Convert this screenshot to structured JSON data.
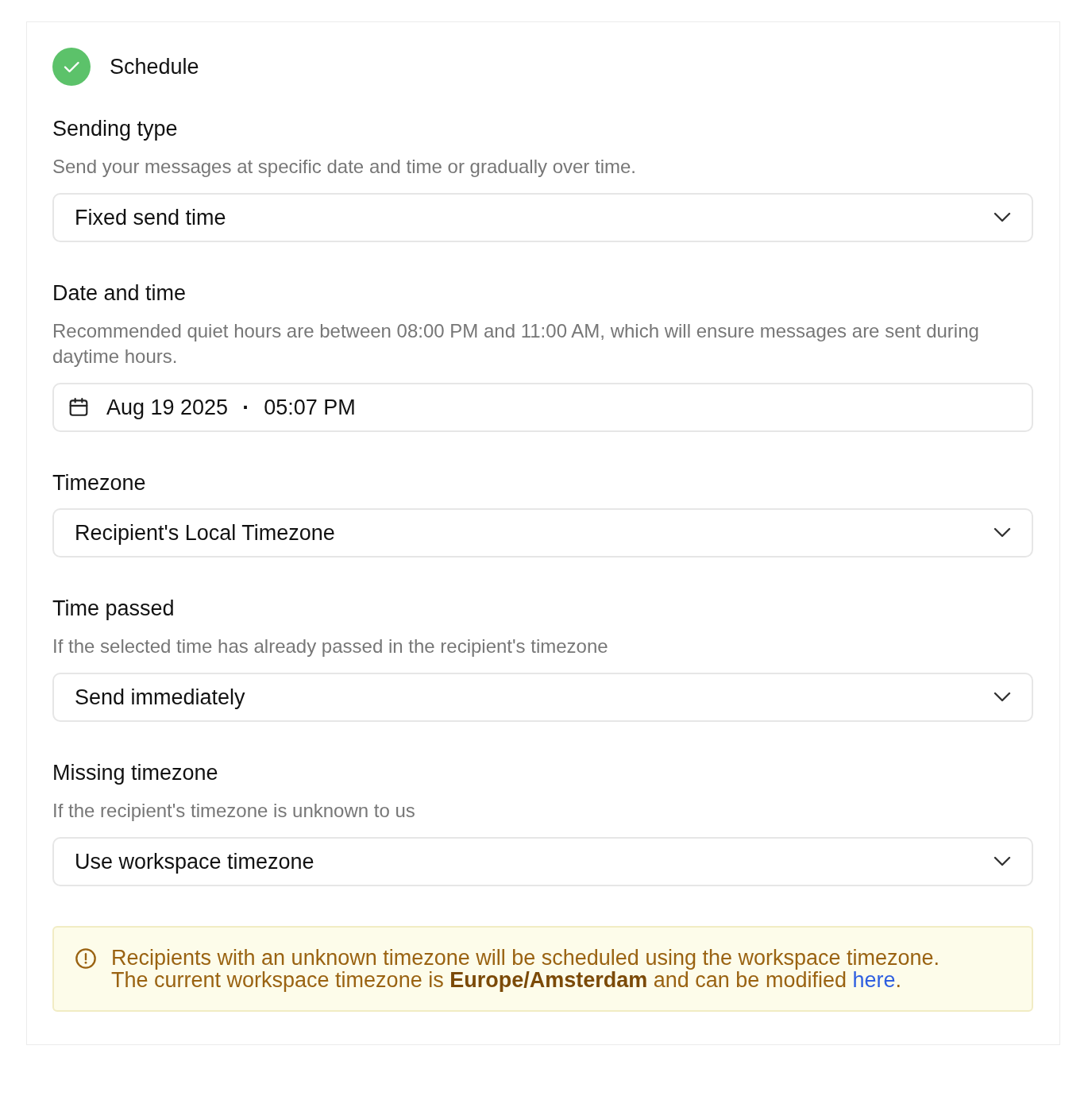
{
  "header": {
    "title": "Schedule",
    "completed": true
  },
  "sections": [
    {
      "kind": "select",
      "title": "Sending type",
      "description": "Send your messages at specific date and time or gradually over time.",
      "value": "Fixed send time"
    },
    {
      "kind": "datetime",
      "title": "Date and time",
      "description": "Recommended quiet hours are between 08:00 PM and 11:00 AM, which will ensure messages are sent during daytime hours.",
      "date": "Aug 19 2025",
      "separator": "·",
      "time": "05:07 PM"
    },
    {
      "kind": "select",
      "title": "Timezone",
      "value": "Recipient's Local Timezone"
    },
    {
      "kind": "select",
      "title": "Time passed",
      "description": "If the selected time has already passed in the recipient's timezone",
      "value": "Send immediately"
    },
    {
      "kind": "select",
      "title": "Missing timezone",
      "description": "If the recipient's timezone is unknown to us",
      "value": "Use workspace timezone"
    }
  ],
  "alert": {
    "text": "Recipients with an unknown timezone will be scheduled using the workspace timezone. The current workspace timezone is **Europe/Amsterdam** and can be modified ",
    "link": "here",
    "after": "."
  }
}
